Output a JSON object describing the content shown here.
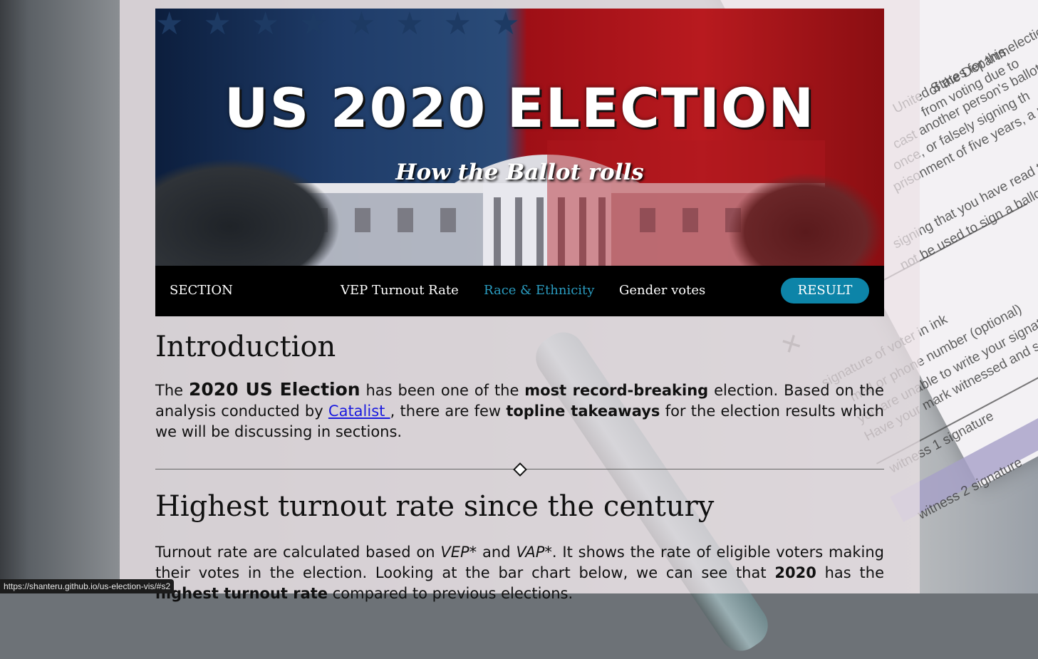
{
  "hero": {
    "title": "US 2020 ELECTION",
    "subtitle": "How the Ballot rolls"
  },
  "nav": {
    "brand": "SECTION",
    "items": [
      {
        "label": "VEP Turnout Rate",
        "active": false
      },
      {
        "label": "Race & Ethnicity",
        "active": true
      },
      {
        "label": "Gender votes",
        "active": false
      }
    ],
    "result_label": "RESULT"
  },
  "intro": {
    "heading": "Introduction",
    "p_the": "The",
    "p_bold1": "2020 US Election",
    "p_text1": "has been one of the",
    "p_bold2": "most record-breaking",
    "p_text2": "election. Based on the analysis conducted by",
    "link": "Catalist ",
    "p_text3": ", there are few",
    "p_bold3": "topline takeaways",
    "p_text4": "for the election results which we will be discussing in sections."
  },
  "turnout": {
    "heading": "Highest turnout rate since the century",
    "t1": "Turnout rate are calculated based on",
    "vep": "VEP*",
    "t2": "and",
    "vap": "VAP*",
    "t3": ". It shows the rate of eligible voters making their votes in the election. Looking at the bar chart below, we can see that",
    "b1": "2020",
    "t4": "has the",
    "b2": "highest turnout rate",
    "t5": "compared to previous elections."
  },
  "background_form": {
    "lines": [
      "of the Departm",
      "from voting due to",
      "United States for this election.",
      "cast another person's ballot. Atte",
      "once, or falsely signing th",
      "prisonment of five years, a maxim",
      "signing that you have read the d",
      "not be used to sign a ballot for so",
      "signature of voter in ink",
      "mail or phone number (optional)",
      "you are unable to write your signature",
      "Have your mark witnessed and s",
      "witness 1 signature",
      "witness 2 signature"
    ]
  },
  "status_url": "https://shanteru.github.io/us-election-vis/#s2",
  "colors": {
    "nav_bg": "#000000",
    "active_nav": "#2a9bbf",
    "result_btn": "#0d84a8",
    "link": "#1a1adf"
  }
}
